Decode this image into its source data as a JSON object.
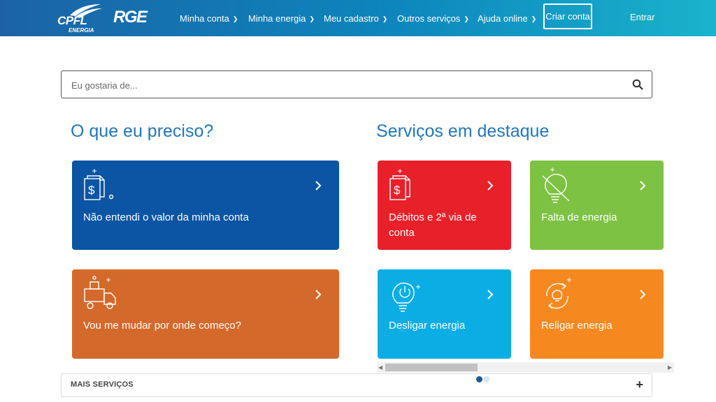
{
  "header": {
    "logo_cpfl": "CPFL",
    "logo_cpfl_sub": "ENERGIA",
    "logo_rge": "RGE",
    "nav": [
      {
        "label": "Minha conta"
      },
      {
        "label": "Minha energia"
      },
      {
        "label": "Meu cadastro"
      },
      {
        "label": "Outros serviços"
      },
      {
        "label": "Ajuda online"
      }
    ],
    "criar_conta": "Criar conta",
    "entrar": "Entrar"
  },
  "search": {
    "placeholder": "Eu gostaria de...",
    "icon": "search-icon"
  },
  "left_section": {
    "title": "O que eu preciso?",
    "cards": [
      {
        "label": "Não entendi o valor da minha conta",
        "icon": "bill-dollar-icon",
        "color": "#0b55a4"
      },
      {
        "label": "Vou me mudar por onde começo?",
        "icon": "moving-truck-icon",
        "color": "#d4692c"
      }
    ]
  },
  "right_section": {
    "title": "Serviços em destaque",
    "cards": [
      {
        "label": "Débitos e 2ª via de conta",
        "icon": "bill-dollar-icon",
        "color": "#e8202a"
      },
      {
        "label": "Falta de energia",
        "icon": "bulb-off-icon",
        "color": "#7dc243"
      },
      {
        "label": "Desligar energia",
        "icon": "bulb-power-icon",
        "color": "#0aaee4"
      },
      {
        "label": "Religar energia",
        "icon": "bulb-cycle-icon",
        "color": "#f5891f"
      }
    ],
    "carousel_dots": 2,
    "active_dot": 0
  },
  "more_services": {
    "label": "MAIS SERVIÇOS",
    "icon": "plus-icon"
  },
  "colors": {
    "header_start": "#1b63a6",
    "header_end": "#1ab3cc",
    "title": "#2376b8",
    "dot_active": "#1a5a96",
    "dot_inactive": "#d8e4ef"
  }
}
